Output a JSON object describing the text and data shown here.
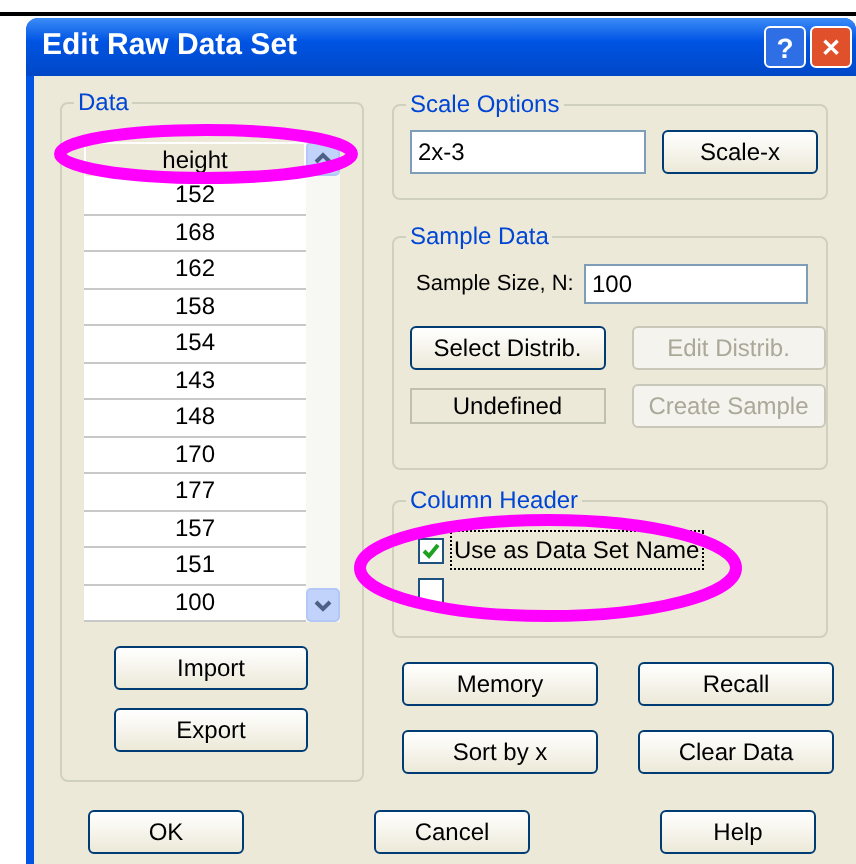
{
  "window": {
    "title": "Edit Raw Data Set",
    "help": "?",
    "close": "✕"
  },
  "data": {
    "legend": "Data",
    "column": "height",
    "values": [
      "152",
      "168",
      "162",
      "158",
      "154",
      "143",
      "148",
      "170",
      "177",
      "157",
      "151",
      "100"
    ],
    "buttons": [
      {
        "label": "Import"
      },
      {
        "label": "Export"
      }
    ]
  },
  "scale_options": {
    "legend": "Scale Options",
    "expression": "2x-3",
    "button": "Scale-x"
  },
  "sample_data": {
    "legend": "Sample Data",
    "size_label": "Sample Size, N:",
    "size": "100",
    "buttons": [
      {
        "label": "Select Distrib.",
        "disabled": false
      },
      {
        "label": "Edit Distrib.",
        "disabled": true
      }
    ],
    "status": "Undefined",
    "create": {
      "label": "Create Sample",
      "disabled": true
    }
  },
  "column_header": {
    "legend": "Column Header",
    "options": [
      {
        "label": "Use as Data Set Name",
        "checked": true
      },
      {
        "checked": false
      }
    ]
  },
  "actions": [
    {
      "label": "Memory"
    },
    {
      "label": "Recall"
    },
    {
      "label": "Sort by x"
    },
    {
      "label": "Clear Data"
    }
  ],
  "footer": [
    {
      "label": "OK"
    },
    {
      "label": "Cancel"
    },
    {
      "label": "Help"
    }
  ]
}
